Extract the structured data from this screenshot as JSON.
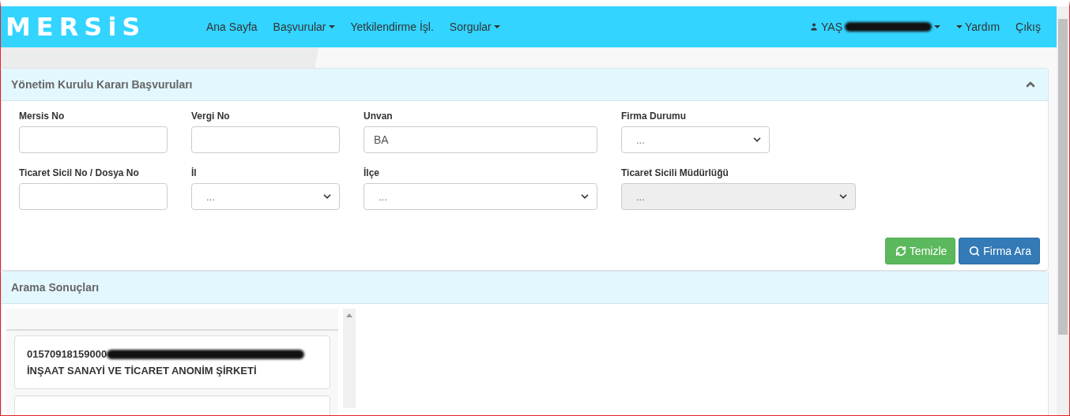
{
  "navbar": {
    "brand": "MERSiS",
    "items": [
      {
        "label": "Ana Sayfa",
        "dropdown": false
      },
      {
        "label": "Başvurular",
        "dropdown": true
      },
      {
        "label": "Yetkilendirme İşl.",
        "dropdown": false
      },
      {
        "label": "Sorgular",
        "dropdown": true
      }
    ],
    "user": {
      "label": "YAŞ"
    },
    "right_items": [
      {
        "label": "Yardım",
        "caret_before": true
      },
      {
        "label": "Çıkış",
        "caret_before": false
      }
    ]
  },
  "search_panel": {
    "title": "Yönetim Kurulu Kararı Başvuruları",
    "expanded": true,
    "rows": [
      [
        {
          "label": "Mersis No",
          "kind": "input"
        },
        {
          "label": "Vergi No",
          "kind": "input"
        },
        {
          "label": "Unvan",
          "kind": "input",
          "value": "BA"
        },
        {
          "label": "Firma Durumu",
          "kind": "select",
          "value": "...",
          "disabled": false
        }
      ],
      [
        {
          "label": "Ticaret Sicil No / Dosya No",
          "kind": "input"
        },
        {
          "label": "İl",
          "kind": "select",
          "value": "...",
          "disabled": false
        },
        {
          "label": "İlçe",
          "kind": "select",
          "value": "...",
          "disabled": false
        },
        {
          "label": "Ticaret Sicili Müdürlüğü",
          "kind": "select",
          "value": "...",
          "disabled": true
        }
      ]
    ],
    "buttons": [
      {
        "label": "Temizle",
        "kind": "clear"
      },
      {
        "label": "Firma Ara",
        "kind": "search"
      }
    ]
  },
  "results_panel": {
    "title": "Arama Sonuçları",
    "results": [
      {
        "line_1": "01570918159000",
        "line_2": "İNŞAAT SANAYİ VE TİCARET ANONİM ŞİRKETİ"
      }
    ]
  }
}
